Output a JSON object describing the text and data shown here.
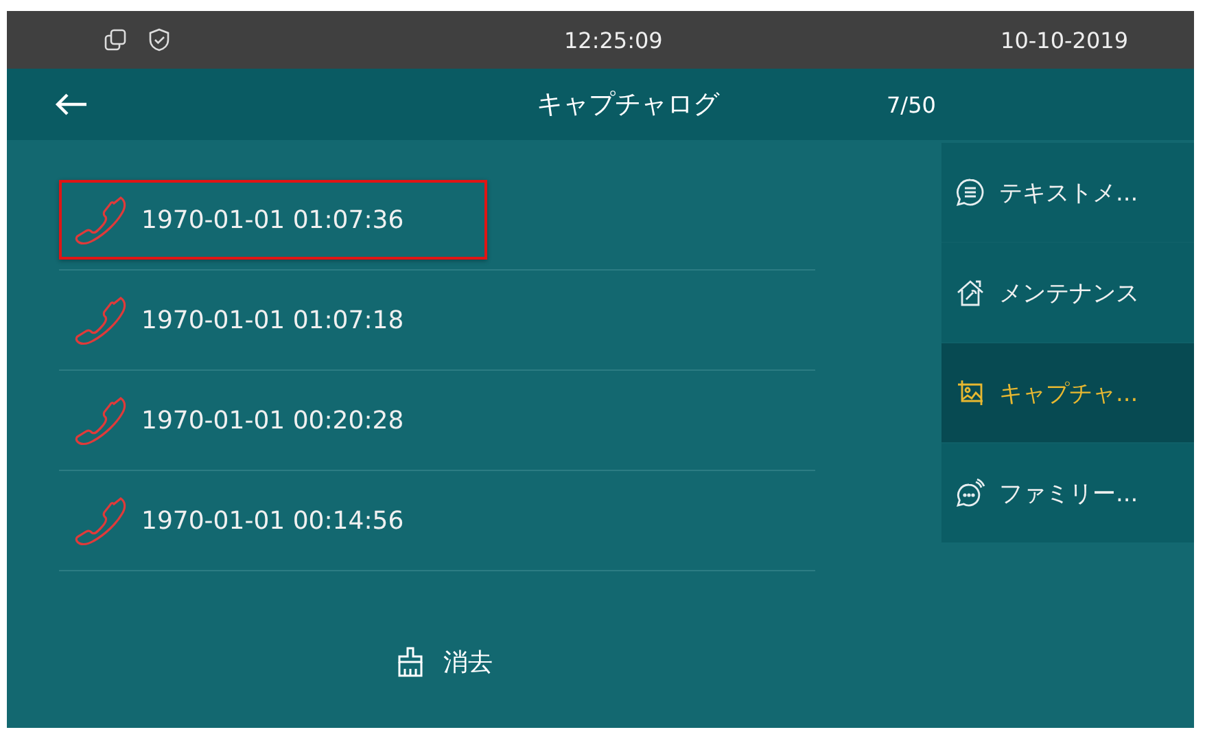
{
  "status_bar": {
    "time": "12:25:09",
    "date": "10-10-2019"
  },
  "header": {
    "title": "キャプチャログ",
    "counter": "7/50"
  },
  "records": [
    {
      "timestamp": "1970-01-01 01:07:36",
      "selected": true
    },
    {
      "timestamp": "1970-01-01 01:07:18",
      "selected": false
    },
    {
      "timestamp": "1970-01-01 00:20:28",
      "selected": false
    },
    {
      "timestamp": "1970-01-01 00:14:56",
      "selected": false
    }
  ],
  "clear_button": {
    "label": "消去"
  },
  "side_menu": [
    {
      "kind": "message",
      "label": "テキストメ...",
      "selected": false
    },
    {
      "kind": "maintenance",
      "label": "メンテナンス",
      "selected": false
    },
    {
      "kind": "capture",
      "label": "キャプチャ...",
      "selected": true
    },
    {
      "kind": "family",
      "label": "ファミリー...",
      "selected": false
    }
  ]
}
